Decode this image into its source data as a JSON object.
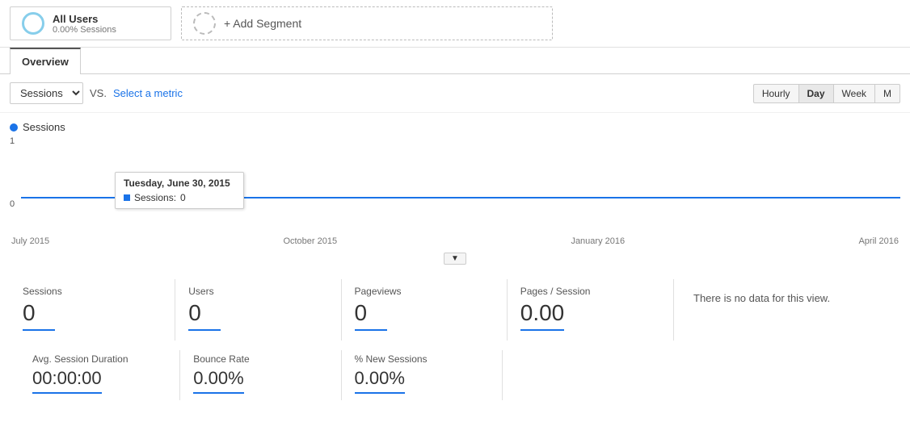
{
  "segments": {
    "segment1": {
      "name": "All Users",
      "sessions": "0.00% Sessions"
    },
    "segment2": {
      "add_label": "+ Add Segment"
    }
  },
  "tabs": [
    {
      "id": "overview",
      "label": "Overview",
      "active": true
    }
  ],
  "toolbar": {
    "metric_default": "Sessions",
    "vs_label": "VS.",
    "select_metric_label": "Select a metric",
    "time_buttons": [
      {
        "label": "Hourly",
        "active": false
      },
      {
        "label": "Day",
        "active": true
      },
      {
        "label": "Week",
        "active": false
      },
      {
        "label": "M",
        "active": false
      }
    ]
  },
  "chart": {
    "legend_label": "Sessions",
    "y_max": "1",
    "y_min": "0",
    "tooltip": {
      "date": "Tuesday, June 30, 2015",
      "sessions_label": "Sessions:",
      "sessions_value": "0"
    },
    "x_labels": [
      "July 2015",
      "October 2015",
      "January 2016",
      "April 2016"
    ]
  },
  "metrics_row1": [
    {
      "label": "Sessions",
      "value": "0"
    },
    {
      "label": "Users",
      "value": "0"
    },
    {
      "label": "Pageviews",
      "value": "0"
    },
    {
      "label": "Pages / Session",
      "value": "0.00"
    }
  ],
  "metrics_row2": [
    {
      "label": "Avg. Session Duration",
      "value": "00:00:00"
    },
    {
      "label": "Bounce Rate",
      "value": "0.00%"
    },
    {
      "label": "% New Sessions",
      "value": "0.00%"
    }
  ],
  "no_data_text": "There is no data for this view."
}
